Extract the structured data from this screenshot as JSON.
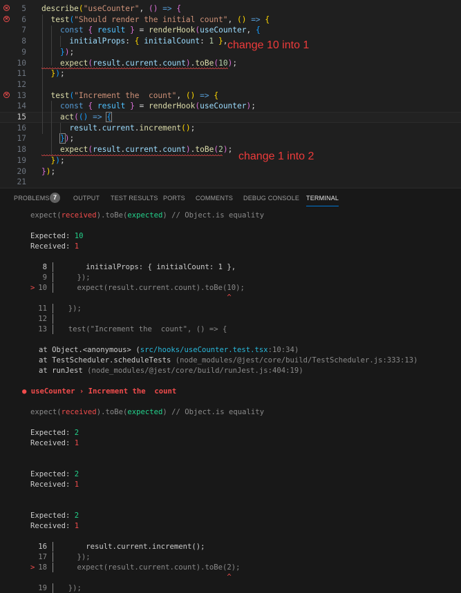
{
  "editor": {
    "lines": [
      {
        "num": "5",
        "error": true,
        "code": [
          [
            "fn",
            "describe"
          ],
          [
            "br1",
            "("
          ],
          [
            "str",
            "\"useCounter\""
          ],
          [
            "pun",
            ", "
          ],
          [
            "br2",
            "()"
          ],
          [
            "pun",
            " "
          ],
          [
            "kw",
            "=>"
          ],
          [
            "pun",
            " "
          ],
          [
            "br2",
            "{"
          ]
        ]
      },
      {
        "num": "6",
        "error": true,
        "code": [
          [
            "pun",
            "  "
          ],
          [
            "fn",
            "test"
          ],
          [
            "br3",
            "("
          ],
          [
            "str",
            "\"Should render the initial count\""
          ],
          [
            "pun",
            ", "
          ],
          [
            "br1",
            "()"
          ],
          [
            "pun",
            " "
          ],
          [
            "kw",
            "=>"
          ],
          [
            "pun",
            " "
          ],
          [
            "br1",
            "{"
          ]
        ]
      },
      {
        "num": "7",
        "error": false,
        "code": [
          [
            "pun",
            "    "
          ],
          [
            "kw",
            "const"
          ],
          [
            "pun",
            " "
          ],
          [
            "br2",
            "{"
          ],
          [
            "pun",
            " "
          ],
          [
            "cst",
            "result"
          ],
          [
            "pun",
            " "
          ],
          [
            "br2",
            "}"
          ],
          [
            "pun",
            " = "
          ],
          [
            "fn",
            "renderHook"
          ],
          [
            "br2",
            "("
          ],
          [
            "var",
            "useCounter"
          ],
          [
            "pun",
            ", "
          ],
          [
            "br3",
            "{"
          ]
        ]
      },
      {
        "num": "8",
        "error": false,
        "code": [
          [
            "pun",
            "      "
          ],
          [
            "var",
            "initialProps"
          ],
          [
            "pun",
            ": "
          ],
          [
            "br1",
            "{"
          ],
          [
            "pun",
            " "
          ],
          [
            "var",
            "initialCount"
          ],
          [
            "pun",
            ": "
          ],
          [
            "num",
            "1"
          ],
          [
            "pun",
            " "
          ],
          [
            "br1",
            "}"
          ],
          [
            "pun",
            ","
          ]
        ]
      },
      {
        "num": "9",
        "error": false,
        "code": [
          [
            "pun",
            "    "
          ],
          [
            "br3",
            "}"
          ],
          [
            "br2",
            ")"
          ],
          [
            "pun",
            ";"
          ]
        ]
      },
      {
        "num": "10",
        "error": false,
        "code": [
          [
            "pun",
            "    "
          ],
          [
            "fn",
            "expect"
          ],
          [
            "br2",
            "("
          ],
          [
            "var",
            "result"
          ],
          [
            "pun",
            "."
          ],
          [
            "var",
            "current"
          ],
          [
            "pun",
            "."
          ],
          [
            "var",
            "count"
          ],
          [
            "br2",
            ")"
          ],
          [
            "pun",
            "."
          ],
          [
            "fn",
            "toBe"
          ],
          [
            "br2",
            "("
          ],
          [
            "num",
            "10"
          ],
          [
            "br2",
            ")"
          ],
          [
            "pun",
            ";"
          ]
        ]
      },
      {
        "num": "11",
        "error": false,
        "code": [
          [
            "pun",
            "  "
          ],
          [
            "br1",
            "}"
          ],
          [
            "br3",
            ")"
          ],
          [
            "pun",
            ";"
          ]
        ]
      },
      {
        "num": "12",
        "error": false,
        "code": []
      },
      {
        "num": "13",
        "error": true,
        "code": [
          [
            "pun",
            "  "
          ],
          [
            "fn",
            "test"
          ],
          [
            "br3",
            "("
          ],
          [
            "str",
            "\"Increment the  count\""
          ],
          [
            "pun",
            ", "
          ],
          [
            "br1",
            "()"
          ],
          [
            "pun",
            " "
          ],
          [
            "kw",
            "=>"
          ],
          [
            "pun",
            " "
          ],
          [
            "br1",
            "{"
          ]
        ]
      },
      {
        "num": "14",
        "error": false,
        "code": [
          [
            "pun",
            "    "
          ],
          [
            "kw",
            "const"
          ],
          [
            "pun",
            " "
          ],
          [
            "br2",
            "{"
          ],
          [
            "pun",
            " "
          ],
          [
            "cst",
            "result"
          ],
          [
            "pun",
            " "
          ],
          [
            "br2",
            "}"
          ],
          [
            "pun",
            " = "
          ],
          [
            "fn",
            "renderHook"
          ],
          [
            "br2",
            "("
          ],
          [
            "var",
            "useCounter"
          ],
          [
            "br2",
            ")"
          ],
          [
            "pun",
            ";"
          ]
        ]
      },
      {
        "num": "15",
        "error": false,
        "current": true,
        "code": [
          [
            "pun",
            "    "
          ],
          [
            "fn",
            "act"
          ],
          [
            "br2",
            "("
          ],
          [
            "br3",
            "()"
          ],
          [
            "pun",
            " "
          ],
          [
            "kw",
            "=>"
          ],
          [
            "pun",
            " "
          ],
          [
            "br3",
            "{"
          ]
        ]
      },
      {
        "num": "16",
        "error": false,
        "code": [
          [
            "pun",
            "      "
          ],
          [
            "var",
            "result"
          ],
          [
            "pun",
            "."
          ],
          [
            "var",
            "current"
          ],
          [
            "pun",
            "."
          ],
          [
            "fn",
            "increment"
          ],
          [
            "br1",
            "()"
          ],
          [
            "pun",
            ";"
          ]
        ]
      },
      {
        "num": "17",
        "error": false,
        "code": [
          [
            "pun",
            "    "
          ],
          [
            "br3",
            "}"
          ],
          [
            "br2",
            ")"
          ],
          [
            "pun",
            ";"
          ]
        ]
      },
      {
        "num": "18",
        "error": false,
        "code": [
          [
            "pun",
            "    "
          ],
          [
            "fn",
            "expect"
          ],
          [
            "br2",
            "("
          ],
          [
            "var",
            "result"
          ],
          [
            "pun",
            "."
          ],
          [
            "var",
            "current"
          ],
          [
            "pun",
            "."
          ],
          [
            "var",
            "count"
          ],
          [
            "br2",
            ")"
          ],
          [
            "pun",
            "."
          ],
          [
            "fn",
            "toBe"
          ],
          [
            "br2",
            "("
          ],
          [
            "num",
            "2"
          ],
          [
            "br2",
            ")"
          ],
          [
            "pun",
            ";"
          ]
        ]
      },
      {
        "num": "19",
        "error": false,
        "code": [
          [
            "pun",
            "  "
          ],
          [
            "br1",
            "}"
          ],
          [
            "br3",
            ")"
          ],
          [
            "pun",
            ";"
          ]
        ]
      },
      {
        "num": "20",
        "error": false,
        "code": [
          [
            "br2",
            "}"
          ],
          [
            "br1",
            ")"
          ],
          [
            "pun",
            ";"
          ]
        ]
      },
      {
        "num": "21",
        "error": false,
        "code": []
      }
    ],
    "annotation_1": "change 10 into 1",
    "annotation_2": "change 1 into 2"
  },
  "panel": {
    "tabs": [
      {
        "label": "PROBLEMS",
        "active": false
      },
      {
        "label": "OUTPUT",
        "active": false
      },
      {
        "label": "TEST RESULTS",
        "active": false
      },
      {
        "label": "PORTS",
        "active": false
      },
      {
        "label": "COMMENTS",
        "active": false
      },
      {
        "label": "DEBUG CONSOLE",
        "active": false
      },
      {
        "label": "TERMINAL",
        "active": true
      }
    ],
    "problems_count": "7"
  },
  "terminal": {
    "expect_hint": {
      "a": "expect(",
      "received": "received",
      "b": ").toBe(",
      "expected": "expected",
      "c": ") // Object.is equality"
    },
    "block1": {
      "expected_label": "Expected: ",
      "expected_value": "10",
      "received_label": "Received: ",
      "received_value": "1",
      "snippet": [
        {
          "num": "8",
          "marker": "",
          "text": "      initialProps: { initialCount: 1 },",
          "bright": true
        },
        {
          "num": "9",
          "marker": "",
          "text": "    });",
          "bright": false
        },
        {
          "num": "10",
          "marker": ">",
          "text": "    expect(result.current.count).toBe(10);",
          "bright": false
        },
        {
          "num": "",
          "marker": "",
          "text": "                                      ^",
          "caret": true
        },
        {
          "num": "11",
          "marker": "",
          "text": "  });",
          "bright": false
        },
        {
          "num": "12",
          "marker": "",
          "text": "",
          "bright": false
        },
        {
          "num": "13",
          "marker": "",
          "text": "  test(\"Increment the  count\", () => {",
          "bright": false
        }
      ],
      "stack": [
        {
          "prefix": "at Object.<anonymous> (",
          "link": "src/hooks/useCounter.test.tsx",
          "suffix": ":10:34)"
        },
        {
          "prefix": "at TestScheduler.scheduleTests ",
          "link": "",
          "suffix": "(node_modules/@jest/core/build/TestScheduler.js:333:13)"
        },
        {
          "prefix": "at runJest ",
          "link": "",
          "suffix": "(node_modules/@jest/core/build/runJest.js:404:19)"
        }
      ]
    },
    "failure_title": "● useCounter › Increment the  count",
    "block2": {
      "groups": [
        {
          "expected_value": "2",
          "received_value": "1"
        },
        {
          "expected_value": "2",
          "received_value": "1"
        },
        {
          "expected_value": "2",
          "received_value": "1"
        }
      ],
      "snippet": [
        {
          "num": "16",
          "marker": "",
          "text": "      result.current.increment();",
          "bright": true
        },
        {
          "num": "17",
          "marker": "",
          "text": "    });",
          "bright": false
        },
        {
          "num": "18",
          "marker": ">",
          "text": "    expect(result.current.count).toBe(2);",
          "bright": false
        },
        {
          "num": "",
          "marker": "",
          "text": "                                      ^",
          "caret": true
        },
        {
          "num": "19",
          "marker": "",
          "text": "  });",
          "bright": false
        }
      ]
    }
  }
}
